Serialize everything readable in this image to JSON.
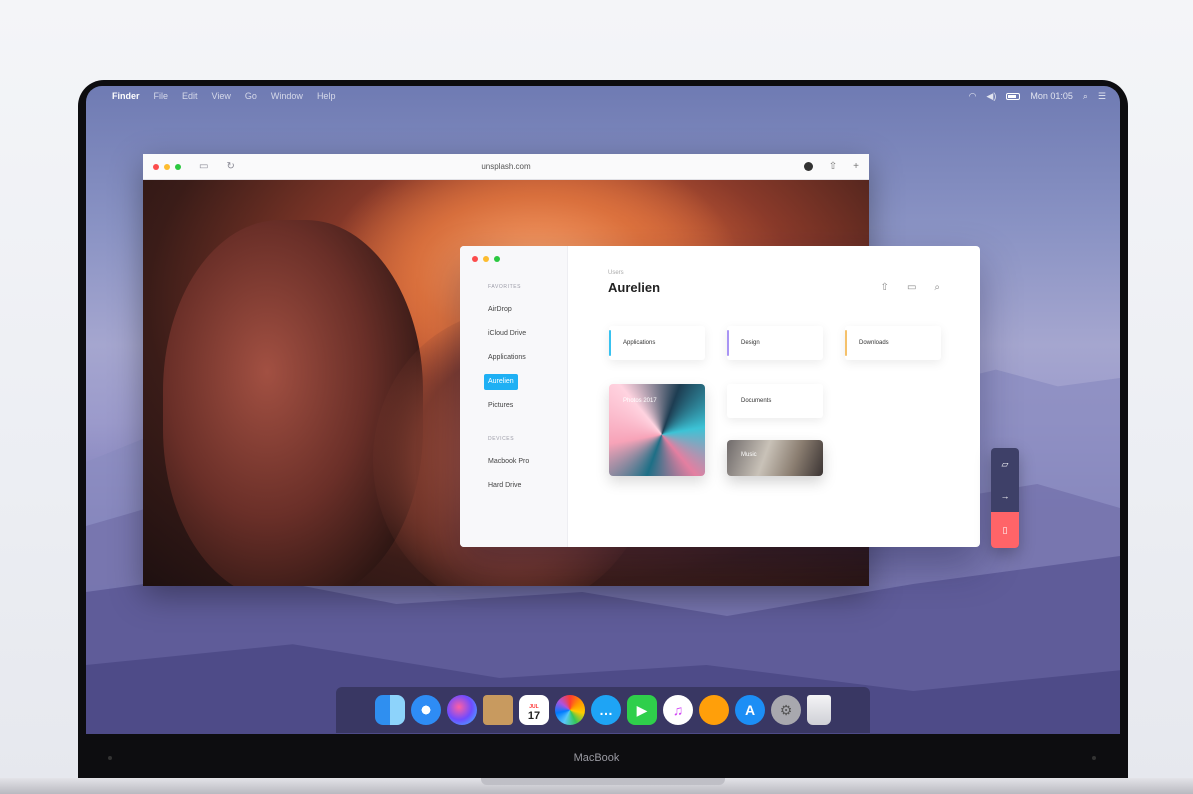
{
  "menubar": {
    "app": "Finder",
    "items": [
      "File",
      "Edit",
      "View",
      "Go",
      "Window",
      "Help"
    ],
    "clock": "Mon 01:05"
  },
  "browser": {
    "url": "unsplash.com"
  },
  "finder": {
    "sidebar": {
      "favorites_header": "FAVORITES",
      "favorites": [
        "AirDrop",
        "iCloud Drive",
        "Applications",
        "Aurelien",
        "Pictures"
      ],
      "active": "Aurelien",
      "devices_header": "DEVICES",
      "devices": [
        "Macbook Pro",
        "Hard Drive"
      ]
    },
    "breadcrumb": "Users",
    "title": "Aurelien",
    "folders": {
      "applications": "Applications",
      "design": "Design",
      "downloads": "Downloads",
      "documents": "Documents",
      "photos": "Photos 2017",
      "music": "Music"
    }
  },
  "dock": {
    "calendar_month": "JUL",
    "calendar_day": "17"
  },
  "laptop": {
    "label": "MacBook"
  },
  "colors": {
    "accent": "#1fb0f4",
    "danger": "#ff6468",
    "applications_bar": "#38c2f0",
    "design_bar": "#a995f4",
    "downloads_bar": "#f5c16b"
  }
}
